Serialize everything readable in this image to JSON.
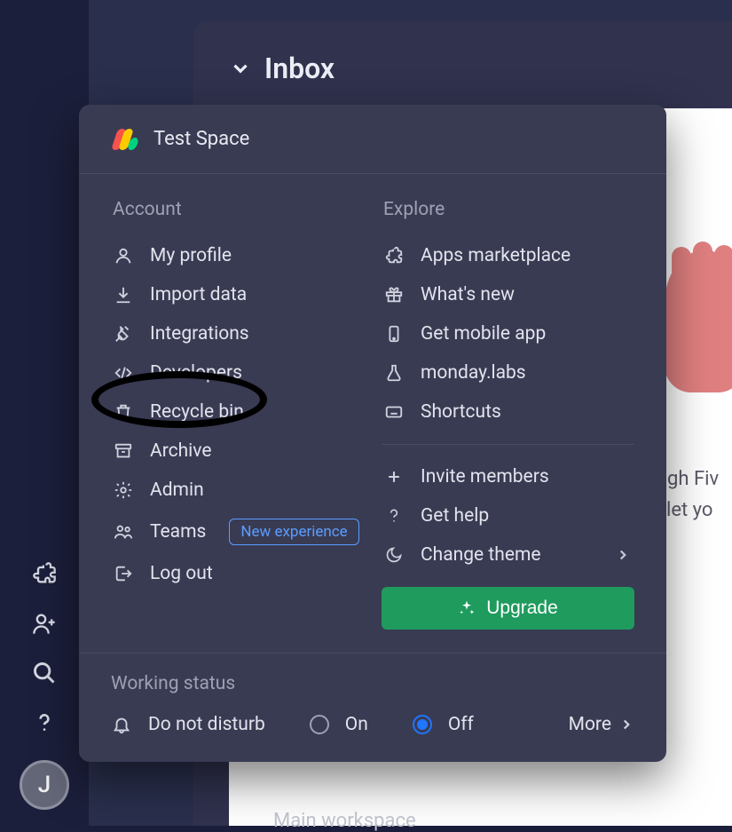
{
  "background": {
    "inbox_title": "Inbox",
    "partial_line1": "High Fiv",
    "partial_line2": "'ll let yo",
    "workspace_label": "Main workspace"
  },
  "rail": {
    "avatar_initial": "J"
  },
  "popup": {
    "space_name": "Test Space",
    "account_label": "Account",
    "explore_label": "Explore",
    "account_items": [
      {
        "id": "my-profile",
        "label": "My profile"
      },
      {
        "id": "import-data",
        "label": "Import data"
      },
      {
        "id": "integrations",
        "label": "Integrations"
      },
      {
        "id": "developers",
        "label": "Developers"
      },
      {
        "id": "recycle-bin",
        "label": "Recycle bin"
      },
      {
        "id": "archive",
        "label": "Archive"
      },
      {
        "id": "admin",
        "label": "Admin"
      },
      {
        "id": "teams",
        "label": "Teams",
        "badge": "New experience"
      },
      {
        "id": "log-out",
        "label": "Log out"
      }
    ],
    "explore_items": [
      {
        "id": "apps-marketplace",
        "label": "Apps marketplace"
      },
      {
        "id": "whats-new",
        "label": "What's new"
      },
      {
        "id": "get-mobile-app",
        "label": "Get mobile app"
      },
      {
        "id": "monday-labs",
        "label": "monday.labs"
      },
      {
        "id": "shortcuts",
        "label": "Shortcuts"
      }
    ],
    "action_items": [
      {
        "id": "invite-members",
        "label": "Invite members"
      },
      {
        "id": "get-help",
        "label": "Get help"
      },
      {
        "id": "change-theme",
        "label": "Change theme",
        "submenu": true
      }
    ],
    "upgrade_label": "Upgrade",
    "working_status": {
      "section_label": "Working status",
      "dnd_label": "Do not disturb",
      "on_label": "On",
      "off_label": "Off",
      "selected": "off",
      "more_label": "More"
    }
  }
}
